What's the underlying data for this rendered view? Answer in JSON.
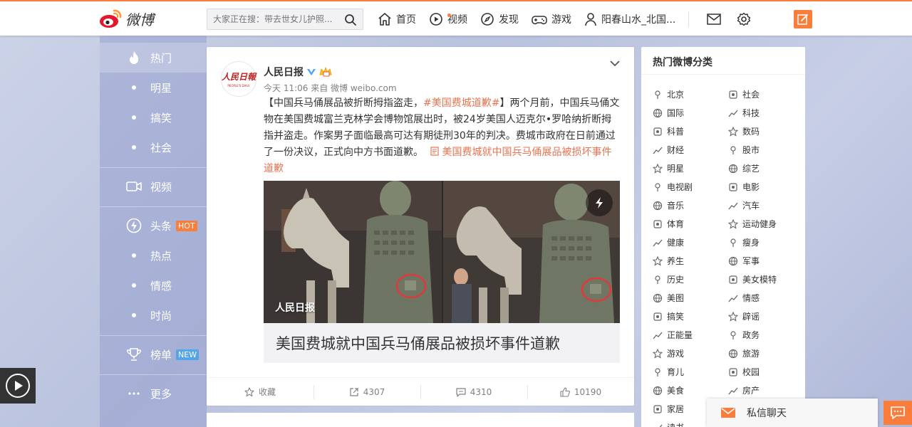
{
  "colors": {
    "accent": "#fa7d3c",
    "link": "#eb7350",
    "verified": "#4fa0ff",
    "sidebar": "#97a0cf"
  },
  "header": {
    "logo_text": "微博",
    "search_placeholder": "大家正在搜：带去世女儿护照...",
    "nav": [
      {
        "label": "首页",
        "icon": "home-icon"
      },
      {
        "label": "视频",
        "icon": "video-play-icon"
      },
      {
        "label": "发现",
        "icon": "compass-icon"
      },
      {
        "label": "游戏",
        "icon": "gamepad-icon"
      },
      {
        "label": "阳春山水_北国...",
        "icon": "user-icon"
      }
    ]
  },
  "leftnav": {
    "hot": "热门",
    "star": "明星",
    "funny": "搞笑",
    "society": "社会",
    "video": "视频",
    "headline": "头条",
    "headline_badge": "HOT",
    "hotspot": "热点",
    "emotion": "情感",
    "fashion": "时尚",
    "ranking": "榜单",
    "ranking_badge": "NEW",
    "more": "更多"
  },
  "post": {
    "author": "人民日报",
    "meta": "今天 11:06 来自 微博 weibo.com",
    "avatar_text": "人民日報",
    "avatar_sub": "PEOPLE'S DAILY",
    "text_before": "【中国兵马俑展品被折断拇指盗走，",
    "tag": "#美国费城道歉#",
    "text_after": "】两个月前，中国兵马俑文物在美国费城富兰克林学会博物馆展出时，被24岁美国人迈克尔•罗哈纳折断拇指并盗走。作案男子面临最高可达有期徒刑30年的判决。费城市政府在日前通过了一份决议，正式向中方书面道歉。",
    "link": "美国费城就中国兵马俑展品被损坏事件道歉",
    "media_caption": "人民日报",
    "media_title": "美国费城就中国兵马俑展品被损坏事件道歉",
    "actions": {
      "favorite": "收藏",
      "repost": "4307",
      "comment": "4310",
      "like": "10190"
    }
  },
  "rightpanel": {
    "title": "热门微博分类",
    "left": [
      "北京",
      "国际",
      "科普",
      "财经",
      "明星",
      "电视剧",
      "音乐",
      "体育",
      "健康",
      "养生",
      "历史",
      "美图",
      "搞笑",
      "正能量",
      "游戏",
      "育儿",
      "美食",
      "家居",
      "读书"
    ],
    "right": [
      "社会",
      "科技",
      "数码",
      "股市",
      "综艺",
      "电影",
      "汽车",
      "运动健身",
      "瘦身",
      "军事",
      "美女模特",
      "情感",
      "辟谣",
      "政务",
      "旅游",
      "校园",
      "房产"
    ]
  },
  "chat": {
    "label": "私信聊天"
  }
}
